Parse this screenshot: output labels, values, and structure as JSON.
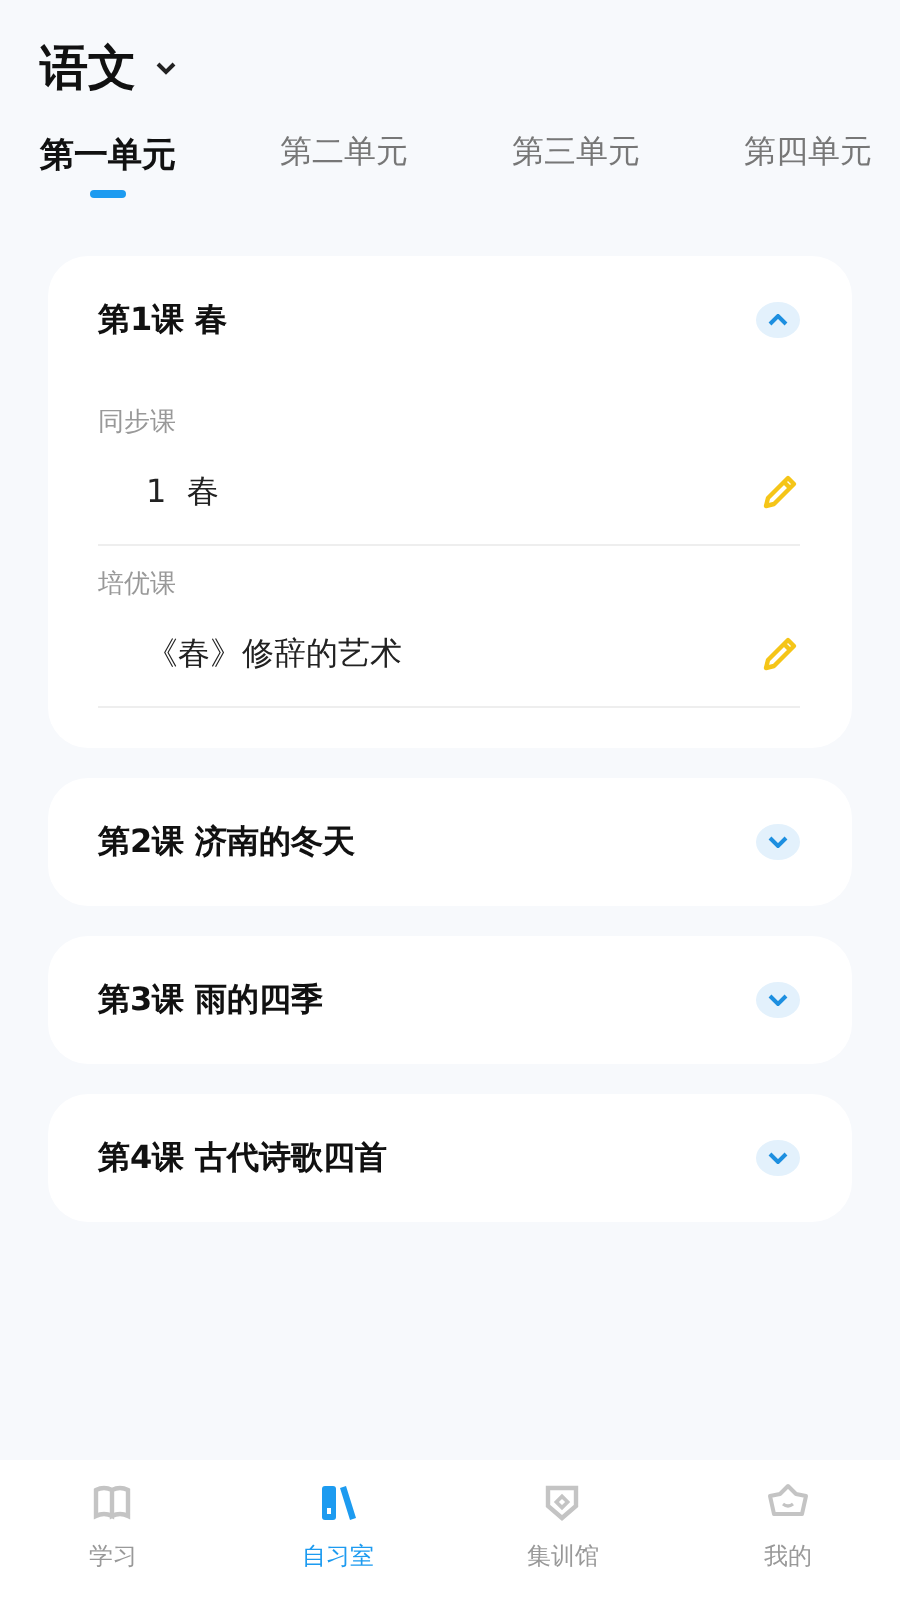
{
  "header": {
    "title": "语文"
  },
  "tabs": [
    {
      "label": "第一单元",
      "selected": true
    },
    {
      "label": "第二单元",
      "selected": false
    },
    {
      "label": "第三单元",
      "selected": false
    },
    {
      "label": "第四单元",
      "selected": false
    }
  ],
  "lessons": [
    {
      "title": "第1课 春",
      "expanded": true,
      "sections": [
        {
          "heading": "同步课",
          "items": [
            "1  春"
          ]
        },
        {
          "heading": "培优课",
          "items": [
            "《春》修辞的艺术"
          ]
        }
      ]
    },
    {
      "title": "第2课 济南的冬天",
      "expanded": false
    },
    {
      "title": "第3课 雨的四季",
      "expanded": false
    },
    {
      "title": "第4课 古代诗歌四首",
      "expanded": false
    }
  ],
  "nav": [
    {
      "label": "学习",
      "kind": "book",
      "selected": false
    },
    {
      "label": "自习室",
      "kind": "shelf",
      "selected": true
    },
    {
      "label": "集训馆",
      "kind": "shield",
      "selected": false
    },
    {
      "label": "我的",
      "kind": "face",
      "selected": false
    }
  ]
}
